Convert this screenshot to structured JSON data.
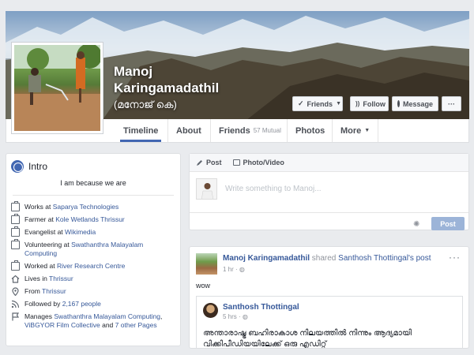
{
  "profile": {
    "name_line1": "Manoj",
    "name_line2": "Karingamadathil",
    "alt_name": "(മനോജ് കെ)"
  },
  "cover_buttons": {
    "friends": "Friends",
    "follow": "Follow",
    "message": "Message",
    "more": "···"
  },
  "nav": {
    "timeline": "Timeline",
    "about": "About",
    "friends": "Friends",
    "friends_count": "57 Mutual",
    "photos": "Photos",
    "more": "More"
  },
  "intro": {
    "title": "Intro",
    "bio": "I am because we are",
    "items": [
      {
        "icon": "briefcase-icon",
        "prefix": "Works at ",
        "link": "Saparya Technologies"
      },
      {
        "icon": "briefcase-icon",
        "prefix": "Farmer at ",
        "link": "Kole Wetlands Thrissur"
      },
      {
        "icon": "briefcase-icon",
        "prefix": "Evangelist at ",
        "link": "Wikimedia"
      },
      {
        "icon": "briefcase-icon",
        "prefix": "Volunteering at ",
        "link": "Swathanthra Malayalam Computing"
      },
      {
        "icon": "briefcase-icon",
        "prefix": "Worked at ",
        "link": "River Research Centre"
      },
      {
        "icon": "home-icon",
        "prefix": "Lives in ",
        "link": "Thrissur"
      },
      {
        "icon": "location-pin-icon",
        "prefix": "From ",
        "link": "Thrissur"
      },
      {
        "icon": "rss-icon",
        "prefix": "Followed by ",
        "link": "2,167 people"
      }
    ],
    "manages": {
      "prefix": "Manages ",
      "link1": "Swathanthra Malayalam Computing",
      "sep1": ", ",
      "link2": "ViBGYOR Film Collective",
      "sep2": " and ",
      "link3": "7 other Pages"
    }
  },
  "composer": {
    "tab_post": "Post",
    "tab_photo": "Photo/Video",
    "placeholder": "Write something to Manoj...",
    "post_button": "Post"
  },
  "feed_post": {
    "author": "Manoj Karingamadathil",
    "action": " shared ",
    "shared_from": "Santhosh Thottingal",
    "suffix": "'s post",
    "time": "1 hr",
    "text": "wow",
    "more": "···",
    "shared": {
      "author": "Santhosh Thottingal",
      "time": "5 hrs",
      "text_line1": "അന്താരാഷ്ട്ര ബഹിരാകാശ നിലയത്തിൽ നിന്നും ആദ്യമായി",
      "text_line2": "വിക്കിപീഡിയയിലേക്ക് ഒരു എഡിറ്റ്"
    }
  },
  "colors": {
    "page_bg": "#e9ebee",
    "link": "#365899",
    "accent": "#4267b2"
  }
}
